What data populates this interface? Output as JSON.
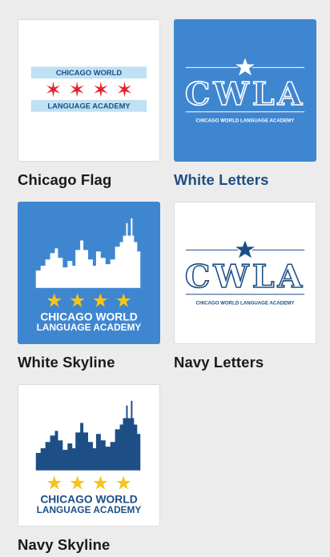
{
  "colors": {
    "blue_bg": "#3f86d1",
    "navy": "#1d4f86",
    "flag_blue": "#bfe1f3",
    "flag_red": "#e3232b",
    "star_yellow": "#f6c515",
    "caption_active": "#1d4f86",
    "caption": "#1a1a1a"
  },
  "tiles": [
    {
      "id": "chicago-flag",
      "caption": "Chicago Flag",
      "line1": "CHICAGO WORLD",
      "line2": "LANGUAGE ACADEMY",
      "stars": "✶ ✶ ✶ ✶"
    },
    {
      "id": "white-letters",
      "caption": "White Letters",
      "monogram": "CWLA",
      "subline": "CHICAGO WORLD LANGUAGE ACADEMY",
      "selected": true
    },
    {
      "id": "white-skyline",
      "caption": "White Skyline",
      "line1": "CHICAGO WORLD",
      "line2": "LANGUAGE ACADEMY"
    },
    {
      "id": "navy-letters",
      "caption": "Navy Letters",
      "monogram": "CWLA",
      "subline": "CHICAGO WORLD LANGUAGE ACADEMY"
    },
    {
      "id": "navy-skyline",
      "caption": "Navy Skyline",
      "line1": "CHICAGO WORLD",
      "line2": "LANGUAGE ACADEMY"
    }
  ]
}
